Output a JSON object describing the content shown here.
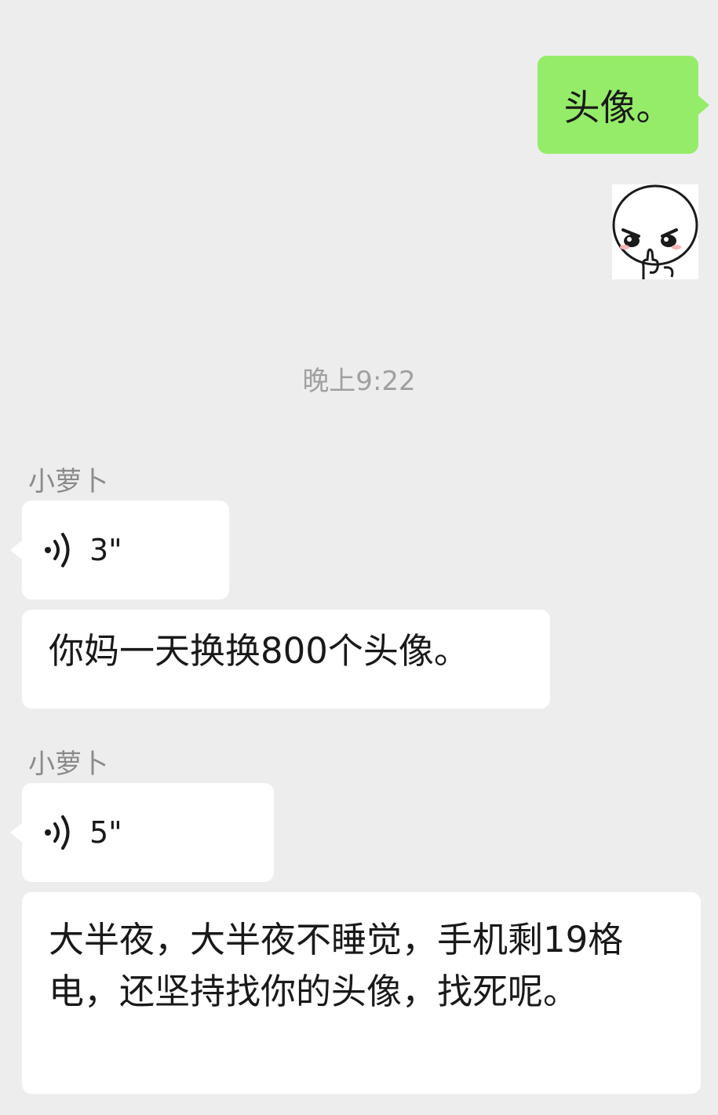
{
  "messages": {
    "outgoing_text": "头像。",
    "timestamp": "晚上9:22",
    "group1": {
      "sender": "小萝卜",
      "voice_duration": "3\"",
      "text": "你妈一天换换800个头像。"
    },
    "group2": {
      "sender": "小萝卜",
      "voice_duration": "5\"",
      "text": "大半夜，大半夜不睡觉，手机剩19格电，还坚持找你的头像，找死呢。"
    }
  },
  "icons": {
    "voice": "voice-wave-icon",
    "sticker": "angry-face-sticker"
  },
  "colors": {
    "background": "#ededed",
    "outgoing_bubble": "#95ec69",
    "incoming_bubble": "#ffffff"
  }
}
